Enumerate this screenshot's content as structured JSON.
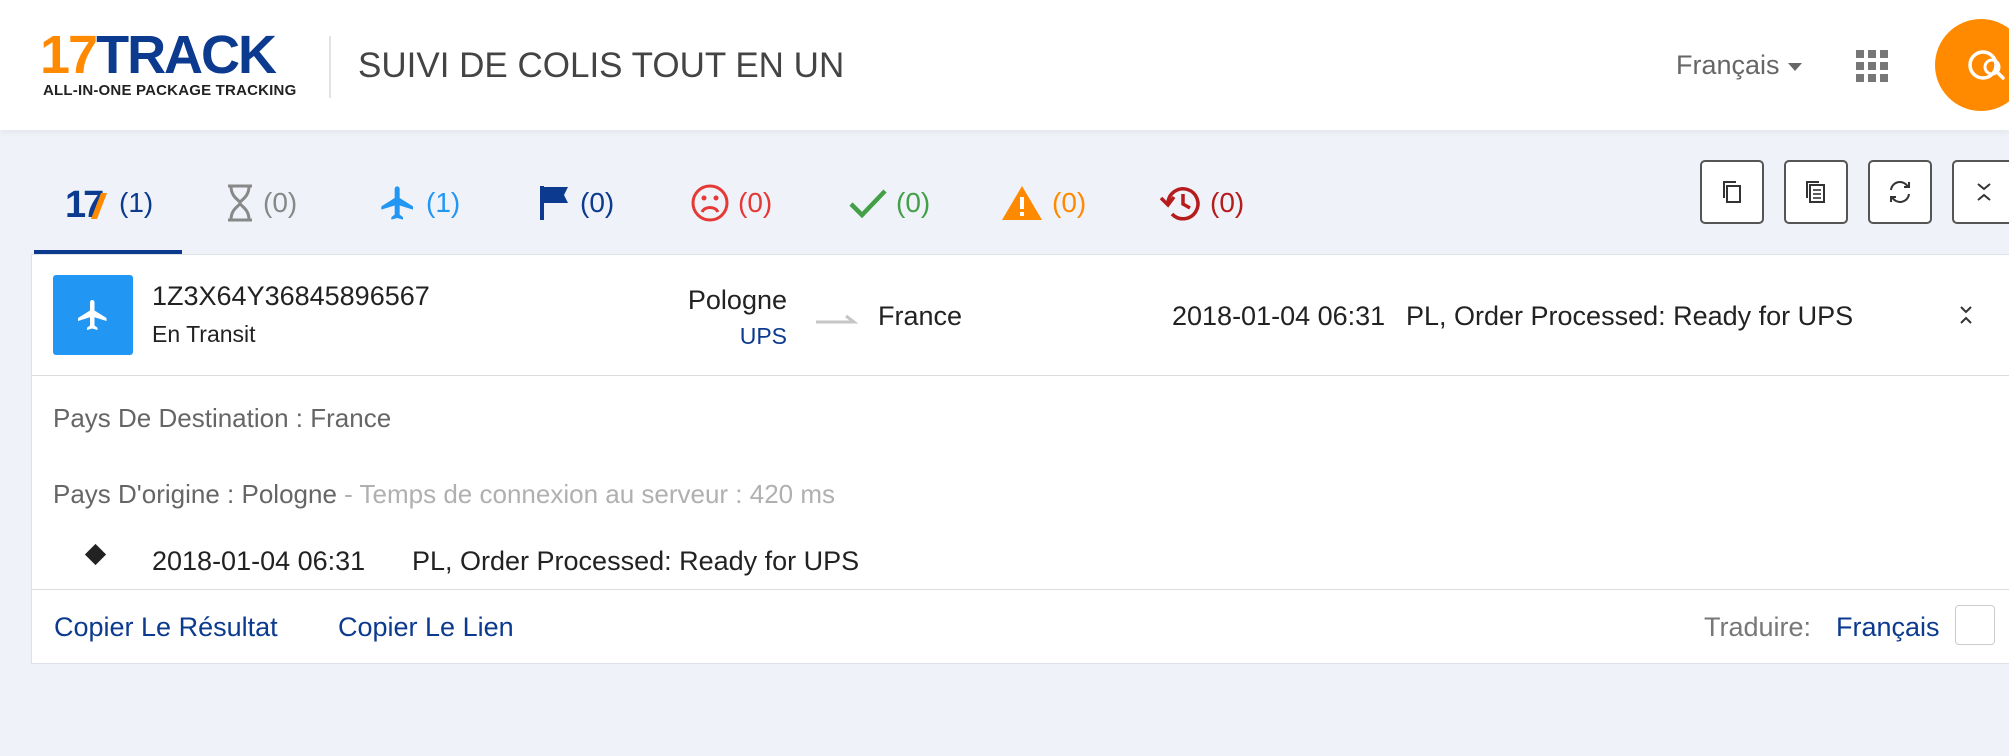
{
  "header": {
    "logo_number": "17",
    "logo_text": "TRACK",
    "logo_tagline": "ALL-IN-ONE PACKAGE TRACKING",
    "title": "SUIVI DE COLIS TOUT EN UN",
    "language": "Français"
  },
  "tabs": [
    {
      "icon": "17track-icon",
      "count": "(1)",
      "color": "#0b3a8f"
    },
    {
      "icon": "hourglass-icon",
      "count": "(0)",
      "color": "#888888"
    },
    {
      "icon": "plane-icon",
      "count": "(1)",
      "color": "#2196f3"
    },
    {
      "icon": "flag-icon",
      "count": "(0)",
      "color": "#0b3a8f"
    },
    {
      "icon": "sad-face-icon",
      "count": "(0)",
      "color": "#e53935"
    },
    {
      "icon": "check-icon",
      "count": "(0)",
      "color": "#43a047"
    },
    {
      "icon": "warning-icon",
      "count": "(0)",
      "color": "#ff8a00"
    },
    {
      "icon": "history-icon",
      "count": "(0)",
      "color": "#b71c1c"
    }
  ],
  "shipment": {
    "tracking_number": "1Z3X64Y36845896567",
    "status": "En Transit",
    "origin": "Pologne",
    "carrier": "UPS",
    "destination": "France",
    "last_time": "2018-01-04 06:31",
    "last_event": "PL, Order Processed: Ready for UPS",
    "detail_destination": "Pays De Destination : France",
    "detail_origin": "Pays D'origine : Pologne",
    "detail_server": " - Temps de connexion au serveur : 420 ms",
    "events": [
      {
        "time": "2018-01-04 06:31",
        "text": "PL, Order Processed: Ready for UPS"
      }
    ]
  },
  "footer": {
    "copy_result": "Copier Le Résultat",
    "copy_link": "Copier Le Lien",
    "translate_label": "Traduire:",
    "translate_value": "Français"
  },
  "colors": {
    "accent": "#ff8a00",
    "brand": "#0b3a8f",
    "transit": "#2196f3"
  }
}
